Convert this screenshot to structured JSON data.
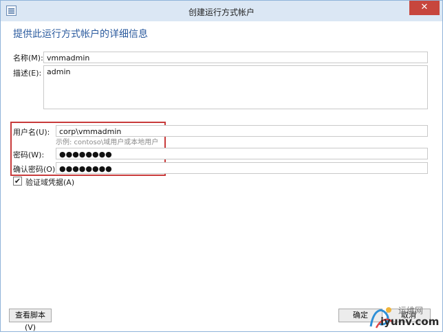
{
  "window": {
    "title": "创建运行方式帐户",
    "close_glyph": "✕"
  },
  "heading": "提供此运行方式帐户的详细信息",
  "form": {
    "name_label": "名称(M):",
    "name_value": "vmmadmin",
    "desc_label": "描述(E):",
    "desc_value": "admin",
    "username_label": "用户名(U):",
    "username_value": "corp\\vmmadmin",
    "username_hint": "示例: contoso\\域用户或本地用户",
    "password_label": "密码(W):",
    "password_value": "●●●●●●●●",
    "confirm_label": "确认密码(O):",
    "confirm_value": "●●●●●●●●",
    "validate_label": "验证域凭据(A)",
    "validate_checked": "✔"
  },
  "buttons": {
    "view_script": "查看脚本(V)",
    "ok": "确定",
    "cancel": "取消"
  },
  "watermark": {
    "top": "运维网",
    "bottom": "iyunv.com"
  },
  "colors": {
    "heading": "#2a5a9e",
    "highlight": "#c83a3a",
    "close": "#c7463d"
  }
}
